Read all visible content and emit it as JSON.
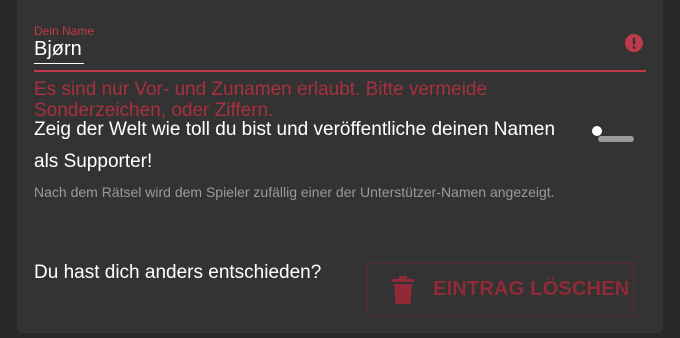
{
  "name_field": {
    "label": "Dein Name",
    "value": "Bjørn",
    "error": "Es sind nur Vor- und Zunamen erlaubt. Bitte vermeide Sonderzeichen, oder Ziffern."
  },
  "supporter": {
    "text": "Zeig der Welt wie toll du bist und veröffentliche deinen Namen als Supporter!",
    "hint": "Nach dem Rätsel wird dem Spieler zufällig einer der Unterstützer-Namen angezeigt.",
    "toggle_on": false
  },
  "delete_section": {
    "question": "Du hast dich anders entschieden?",
    "button_label": "EINTRAG LÖSCHEN"
  },
  "colors": {
    "error": "#c0394a",
    "background": "#282828",
    "card": "#333333"
  }
}
